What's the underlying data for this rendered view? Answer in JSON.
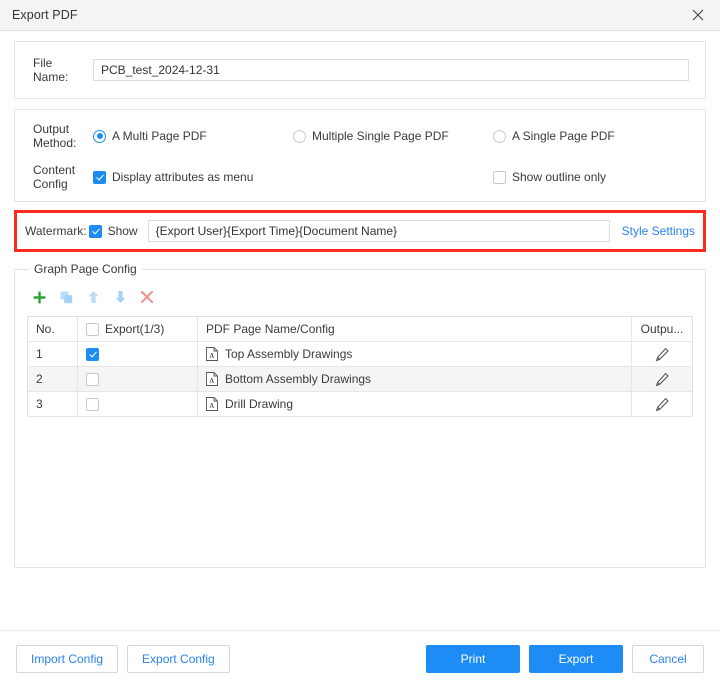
{
  "window": {
    "title": "Export PDF",
    "close_icon": "close-icon"
  },
  "file_name_section": {
    "label_line1": "File",
    "label_line2": "Name:",
    "value": "PCB_test_2024-12-31",
    "placeholder": "File Name"
  },
  "output_method": {
    "label_line1": "Output",
    "label_line2": "Method:",
    "options": [
      {
        "label": "A Multi Page PDF",
        "selected": true
      },
      {
        "label": "Multiple Single Page PDF",
        "selected": false
      },
      {
        "label": "A Single Page PDF",
        "selected": false
      }
    ]
  },
  "content_config": {
    "label_line1": "Content",
    "label_line2": "Config",
    "options": [
      {
        "label": "Display attributes as menu",
        "checked": true
      },
      {
        "label": "Show outline only",
        "checked": false
      }
    ]
  },
  "watermark": {
    "label": "Watermark:",
    "show_label": "Show",
    "show_checked": true,
    "value": "{Export User}{Export Time}{Document Name}",
    "placeholder": "Watermark text",
    "style_settings_link": "Style Settings",
    "highlight_color": "#fd2b1e"
  },
  "graph_page_config": {
    "legend": "Graph Page Config",
    "toolbar": [
      {
        "name": "add-icon",
        "glyph": "plus",
        "color": "#2aa23a",
        "enabled": true
      },
      {
        "name": "duplicate-icon",
        "glyph": "copy",
        "color": "#bcdcf7",
        "enabled": false
      },
      {
        "name": "move-up-icon",
        "glyph": "arrow-up",
        "color": "#bcdcf7",
        "enabled": false
      },
      {
        "name": "move-down-icon",
        "glyph": "arrow-down",
        "color": "#a8d2f5",
        "enabled": false
      },
      {
        "name": "delete-icon",
        "glyph": "cross",
        "color": "#f6a5a0",
        "enabled": false
      }
    ],
    "columns": {
      "no": "No.",
      "export": "Export(1/3)",
      "export_header_checked": false,
      "page_name": "PDF Page Name/Config",
      "output": "Outpu..."
    },
    "rows": [
      {
        "no": "1",
        "checked": true,
        "name": "Top Assembly Drawings",
        "edit_icon": "pencil-icon"
      },
      {
        "no": "2",
        "checked": false,
        "name": "Bottom Assembly Drawings",
        "edit_icon": "pencil-icon"
      },
      {
        "no": "3",
        "checked": false,
        "name": "Drill Drawing",
        "edit_icon": "pencil-icon"
      }
    ]
  },
  "footer": {
    "import_config": "Import Config",
    "export_config": "Export Config",
    "print": "Print",
    "export": "Export",
    "cancel": "Cancel",
    "primary_color": "#1e8cf5",
    "link_color": "#2b82e8"
  }
}
